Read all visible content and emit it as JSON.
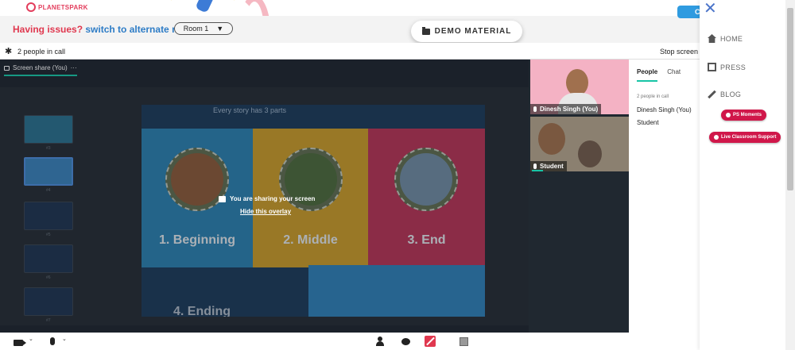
{
  "header": {
    "logo_text": "PLANETSPARK",
    "issue_question": "Having issues?",
    "issue_link": "switch to alternate room",
    "room_label": "Room 1",
    "room_chevron": "▼",
    "demo_label": "DEMO MATERIAL",
    "blue_pill_text": "C"
  },
  "callbar": {
    "gear": "✱",
    "people_text": "2 people in call",
    "stop_text": "Stop screen"
  },
  "stage": {
    "tab_label": "Screen share (You)",
    "tab_more": "···",
    "slide_title": "Every story has 3 parts",
    "panels": [
      "1. Beginning",
      "2. Middle",
      "3. End"
    ],
    "bottom_text": "4. Ending",
    "thumb_numbers": [
      "#3",
      "#4",
      "#5",
      "#6",
      "#7",
      "#8"
    ],
    "overlay_text": "You are sharing your screen",
    "overlay_link": "Hide this overlay"
  },
  "videos": [
    {
      "name": "Dinesh Singh (You)"
    },
    {
      "name": "Student"
    }
  ],
  "sidepanel": {
    "tabs": [
      "People",
      "Chat"
    ],
    "count": "2 people in call",
    "people": [
      "Dinesh Singh (You)",
      "Student"
    ]
  },
  "controls": {
    "chevron": "⌄"
  },
  "menu": {
    "close": "✕",
    "items": [
      "HOME",
      "PRESS",
      "BLOG"
    ],
    "ps_moments": "PS Moments",
    "support": "Live Classroom Support"
  },
  "colors": {
    "accent": "#18c4a6",
    "brand": "#e33d5c",
    "link": "#2d7cc6",
    "pill": "#d0174a"
  }
}
